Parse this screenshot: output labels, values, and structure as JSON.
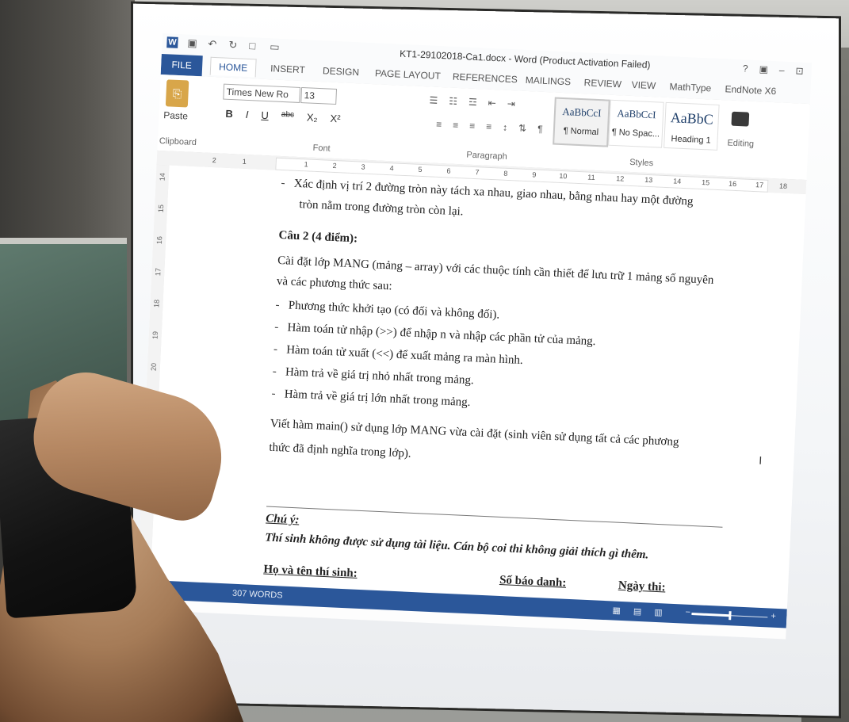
{
  "word": {
    "title": "KT1-29102018-Ca1.docx - Word (Product Activation Failed)",
    "title_controls": [
      "?",
      "▣",
      "–",
      "⊡"
    ],
    "tabs": [
      "FILE",
      "HOME",
      "INSERT",
      "DESIGN",
      "PAGE LAYOUT",
      "REFERENCES",
      "MAILINGS",
      "REVIEW",
      "VIEW",
      "MathType",
      "EndNote X6"
    ],
    "active_tab": "HOME",
    "ribbon": {
      "paste_label": "Paste",
      "clipboard_label": "Clipboard",
      "font_name": "Times New Ro",
      "font_size": "13",
      "font_label": "Font",
      "paragraph_label": "Paragraph",
      "styles_label": "Styles",
      "editing_label": "Editing",
      "format_buttons": [
        "B",
        "I",
        "U",
        "abc",
        "X₂",
        "X²"
      ],
      "styles": [
        {
          "sample": "AaBbCcI",
          "name": "¶ Normal"
        },
        {
          "sample": "AaBbCcI",
          "name": "¶ No Spac..."
        },
        {
          "sample": "AaBbC",
          "name": "Heading 1"
        }
      ]
    },
    "ruler_numbers": [
      "2",
      "1",
      "1",
      "2",
      "3",
      "4",
      "5",
      "6",
      "7",
      "8",
      "9",
      "10",
      "11",
      "12",
      "13",
      "14",
      "15",
      "16",
      "17",
      "18"
    ],
    "vertical_ruler_numbers": [
      "14",
      "15",
      "16",
      "17",
      "18",
      "19",
      "20"
    ],
    "status": {
      "word_count": "307 WORDS",
      "zoom_level": 0.5
    }
  },
  "document": {
    "line1": "Xác định vị trí 2 đường tròn này tách xa nhau, giao nhau, bằng nhau hay một đường",
    "line2": "tròn nằm trong đường tròn còn lại.",
    "q2_heading": "Câu 2 (4 điểm):",
    "q2_intro1": "Cài đặt lớp MANG (mảng – array) với các thuộc tính cần thiết để lưu trữ 1 mảng số nguyên",
    "q2_intro2": "và các phương thức sau:",
    "bullets": [
      "Phương thức khởi tạo (có đối và không đối).",
      "Hàm toán tử nhập (>>) để nhập n và nhập các phần tử của mảng.",
      "Hàm toán tử xuất (<<) để xuất mảng ra màn hình.",
      "Hàm trả về giá trị nhỏ nhất trong mảng.",
      "Hàm trả về giá trị lớn nhất trong mảng."
    ],
    "main_line1": "Viết hàm main() sử dụng lớp MANG vừa cài đặt (sinh viên sử dụng tất cả các phương",
    "main_line2": "thức đã định nghĩa trong lớp).",
    "note_heading": "Chú ý:",
    "note_text": "Thí sinh không được sử dụng tài liệu. Cán bộ coi thi không giải thích gì thêm.",
    "footer_name": "Họ và tên thí sinh:",
    "footer_id": "Số báo danh:",
    "footer_date": "Ngày thi:"
  },
  "colors": {
    "word_blue": "#2b579a",
    "page_white": "#ffffff"
  }
}
